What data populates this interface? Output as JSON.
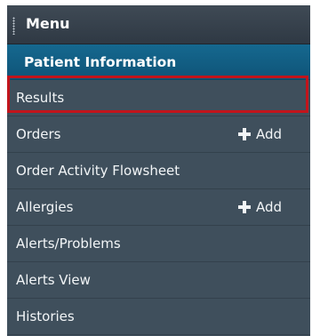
{
  "menu": {
    "title": "Menu",
    "section": "Patient Information",
    "items": [
      {
        "label": "Results",
        "add": null
      },
      {
        "label": "Orders",
        "add": "Add"
      },
      {
        "label": "Order Activity Flowsheet",
        "add": null
      },
      {
        "label": "Allergies",
        "add": "Add"
      },
      {
        "label": "Alerts/Problems",
        "add": null
      },
      {
        "label": "Alerts View",
        "add": null
      },
      {
        "label": "Histories",
        "add": null
      }
    ],
    "highlighted_item": "Results",
    "colors": {
      "background": "#3f4f5c",
      "section": "#15688f",
      "highlight": "#c2141b"
    }
  }
}
